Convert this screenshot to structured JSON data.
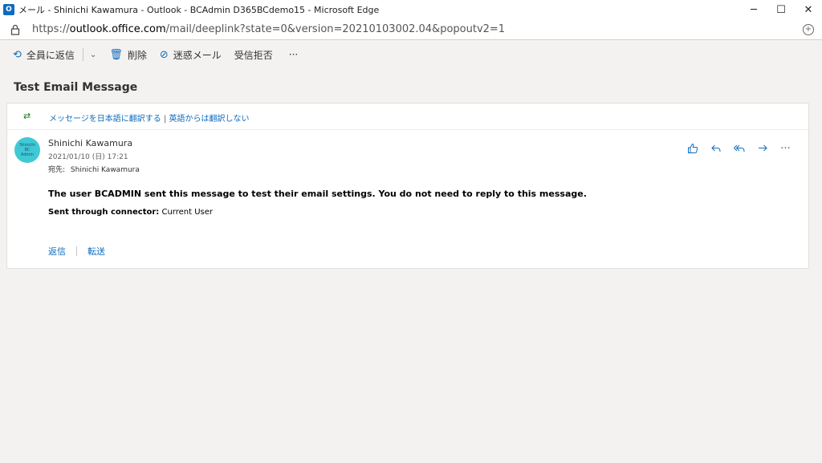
{
  "window": {
    "app_icon": "outlook-icon",
    "app_icon_letter": "O",
    "title": "メール - Shinichi Kawamura - Outlook - BCAdmin D365BCdemo15 - Microsoft Edge",
    "controls": {
      "minimize": "─",
      "maximize": "☐",
      "close": "✕"
    }
  },
  "address": {
    "protocol": "https://",
    "host": "outlook.office.com",
    "path": "/mail/deeplink?state=0&version=20210103002.04&popoutv2=1"
  },
  "toolbar": {
    "reply_all": "全員に返信",
    "delete": "削除",
    "junk": "迷惑メール",
    "block": "受信拒否",
    "more": "···"
  },
  "email": {
    "subject": "Test Email Message",
    "translate_offer": "メッセージを日本語に翻訳する",
    "translate_sep": " | ",
    "translate_never": "英語からは翻訳しない",
    "avatar_text": [
      "Shinichi",
      "BC",
      "Admin"
    ],
    "sender": "Shinichi Kawamura",
    "date": "2021/01/10 (日) 17:21",
    "to_label": "宛先:",
    "to_value": "Shinichi Kawamura",
    "body_line1": "The user BCADMIN sent this message to test their email settings. You do not need to reply to this message.",
    "body_line2_key": "Sent through connector:",
    "body_line2_value": " Current User",
    "reply_label": "返信",
    "forward_label": "転送"
  },
  "colors": {
    "accent": "#0f6cbd",
    "background": "#f3f2f1",
    "card": "#ffffff",
    "avatar": "#3fc9d4"
  }
}
